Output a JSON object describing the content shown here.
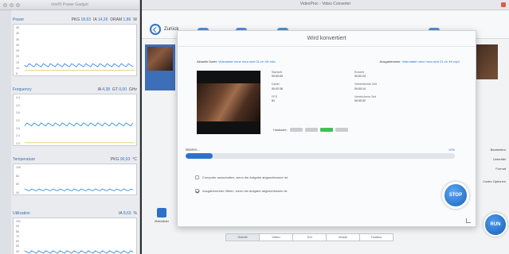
{
  "power_gadget": {
    "title": "Intel® Power Gadget",
    "panels": [
      {
        "name": "Power",
        "readouts": [
          {
            "k": "PKG",
            "v": "18,63"
          },
          {
            "k": "IA",
            "v": "14,26"
          },
          {
            "k": "DRAM",
            "v": "1,86"
          }
        ],
        "unit": "W",
        "yticks": [
          "45",
          "40",
          "35",
          "30",
          "25",
          "20",
          "15",
          "10",
          "5"
        ]
      },
      {
        "name": "Frequency",
        "readouts": [
          {
            "k": "IA",
            "v": "4,38"
          },
          {
            "k": "GT",
            "v": "0,00"
          }
        ],
        "unit": "GHz",
        "yticks": [
          "4.4",
          "4.0",
          "3.6",
          "3.2",
          "2.8",
          "2.4",
          "2.0"
        ]
      },
      {
        "name": "Temperature",
        "readouts": [
          {
            "k": "PKG",
            "v": "90,93"
          }
        ],
        "unit": "°C",
        "yticks": [
          "100",
          "80",
          "60",
          "40"
        ]
      },
      {
        "name": "Utilization",
        "readouts": [
          {
            "k": "IA",
            "v": "8,63"
          }
        ],
        "unit": "%",
        "yticks": [
          "100",
          "90",
          "80",
          "70",
          "60",
          "50",
          "40",
          "30"
        ]
      }
    ]
  },
  "converter": {
    "window_title": "VideoProc - Video Converter",
    "back_label": "Zurück",
    "right_side_labels": [
      "Bearbeiten",
      "Untertitel",
      "Format",
      "Codec Optionen"
    ],
    "left_side_button": "Zielordner",
    "bottom_tabs": [
      "Schnitt",
      "Video",
      "Ton",
      "Musik",
      "Toolbox"
    ],
    "run_label": "RUN",
    "colors": {
      "accent": "#2d72c8",
      "success": "#3fc159"
    }
  },
  "dialog": {
    "title": "Wird konvertiert",
    "source_label": "Aktuelle Datei:",
    "source_value": "Videodatei ohne hora sind 01-ch 4K.mkv",
    "output_label": "Ausgabename:",
    "output_value": "Videodatei ohne hora sind 01-ch 4K.mp4",
    "left_info": [
      {
        "label": "Startzeit",
        "value": "00:00:00"
      },
      {
        "label": "Dauer",
        "value": "00:02:36"
      },
      {
        "label": "FPS",
        "value": "81"
      }
    ],
    "right_info": [
      {
        "label": "Endzeit",
        "value": "00:02:24"
      },
      {
        "label": "Verbleibende Zeit",
        "value": "00:00:14"
      },
      {
        "label": "Verstrichene Zeit",
        "value": "00:00:02"
      }
    ],
    "hardware_label": "Hardware:",
    "hardware_chips": [
      {
        "name": "Intel",
        "on": false
      },
      {
        "name": "Nvidia",
        "on": false
      },
      {
        "name": "AMD",
        "on": true
      },
      {
        "name": "CPU",
        "on": false
      }
    ],
    "status_text": "Warten...",
    "progress_percent": 10,
    "progress_text": "10%",
    "option_shutdown": "Computer ausschalten, wenn die Aufgabe abgeschlossen ist",
    "option_open_folder": "Ausgabeordner öffnen, wenn die Aufgabe abgeschlossen ist",
    "shutdown_checked": false,
    "open_folder_checked": true,
    "stop_label": "STOP"
  }
}
